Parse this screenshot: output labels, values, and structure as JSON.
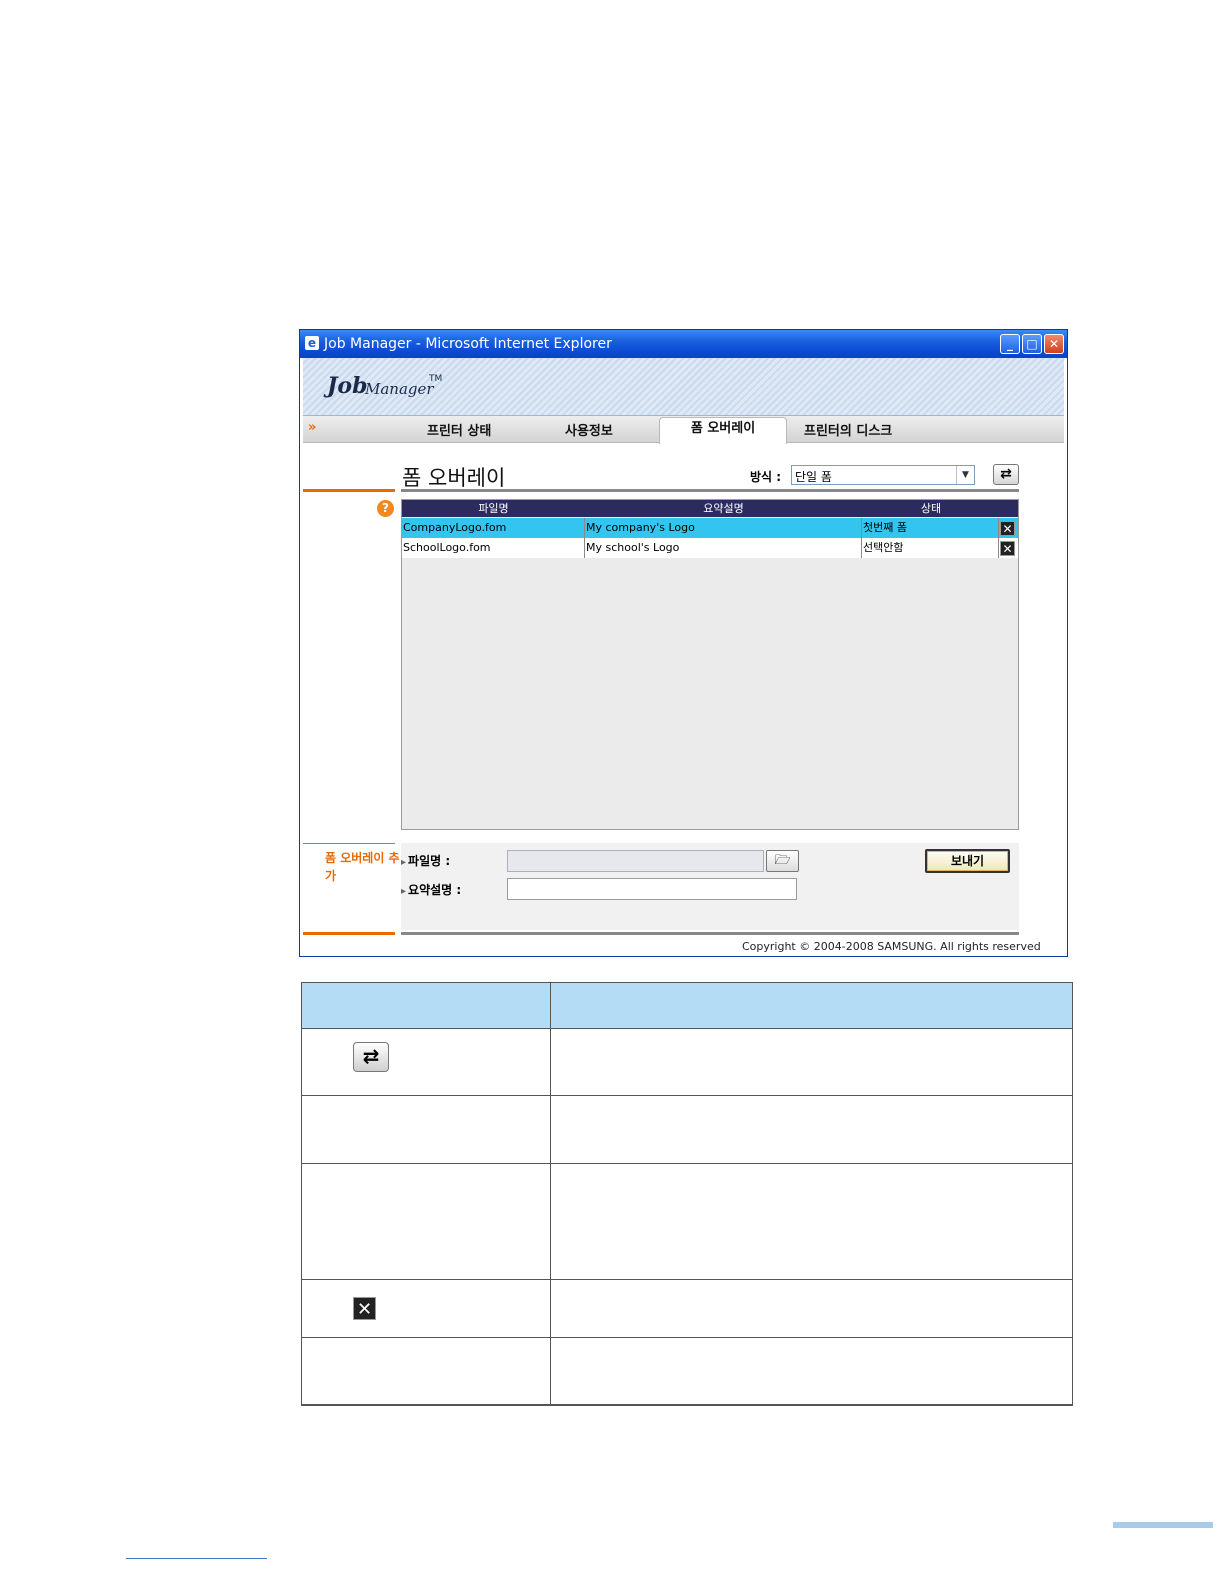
{
  "window": {
    "title": "Job Manager - Microsoft Internet Explorer",
    "minimize": "_",
    "maximize": "□",
    "close": "✕"
  },
  "app": {
    "logo_job": "Job",
    "logo_manager": "Manager",
    "logo_tm": "TM",
    "tab_arrow": "»",
    "tabs": [
      {
        "label": "프린터 상태"
      },
      {
        "label": "사용정보"
      },
      {
        "label": "폼 오버레이"
      },
      {
        "label": "프린터의 디스크"
      }
    ],
    "active_tab": "폼 오버레이"
  },
  "form_overlay": {
    "page_title": "폼 오버레이",
    "mode_label": "방식 :",
    "mode_value": "단일 폼",
    "mode_arrow": "▼",
    "refresh_glyph": "⇄",
    "help_glyph": "?",
    "columns": [
      "파일명",
      "요약설명",
      "상태"
    ],
    "rows": [
      {
        "filename": "CompanyLogo.fom",
        "description": "My company's Logo",
        "status": "첫번째 폼",
        "selected": true
      },
      {
        "filename": "SchoolLogo.fom",
        "description": "My school's Logo",
        "status": "선택안함",
        "selected": false
      }
    ],
    "delete_glyph": "✕"
  },
  "add_panel": {
    "section_label": "폼 오버레이 추가",
    "filename_label": "파일명 :",
    "description_label": "요약설명 :",
    "folder_glyph": "🗁",
    "send_button": "보내기"
  },
  "copyright": "Copyright © 2004-2008 SAMSUNG. All rights reserved",
  "desc_table": {
    "refresh_glyph": "⇄",
    "delete_glyph": "✕"
  },
  "colors": {
    "title_bar": "#0c4bd3",
    "accent_orange": "#e86a00",
    "grid_header": "#2b2b60",
    "selected_row": "#34c4f0",
    "table_header": "#b4dcf4"
  }
}
